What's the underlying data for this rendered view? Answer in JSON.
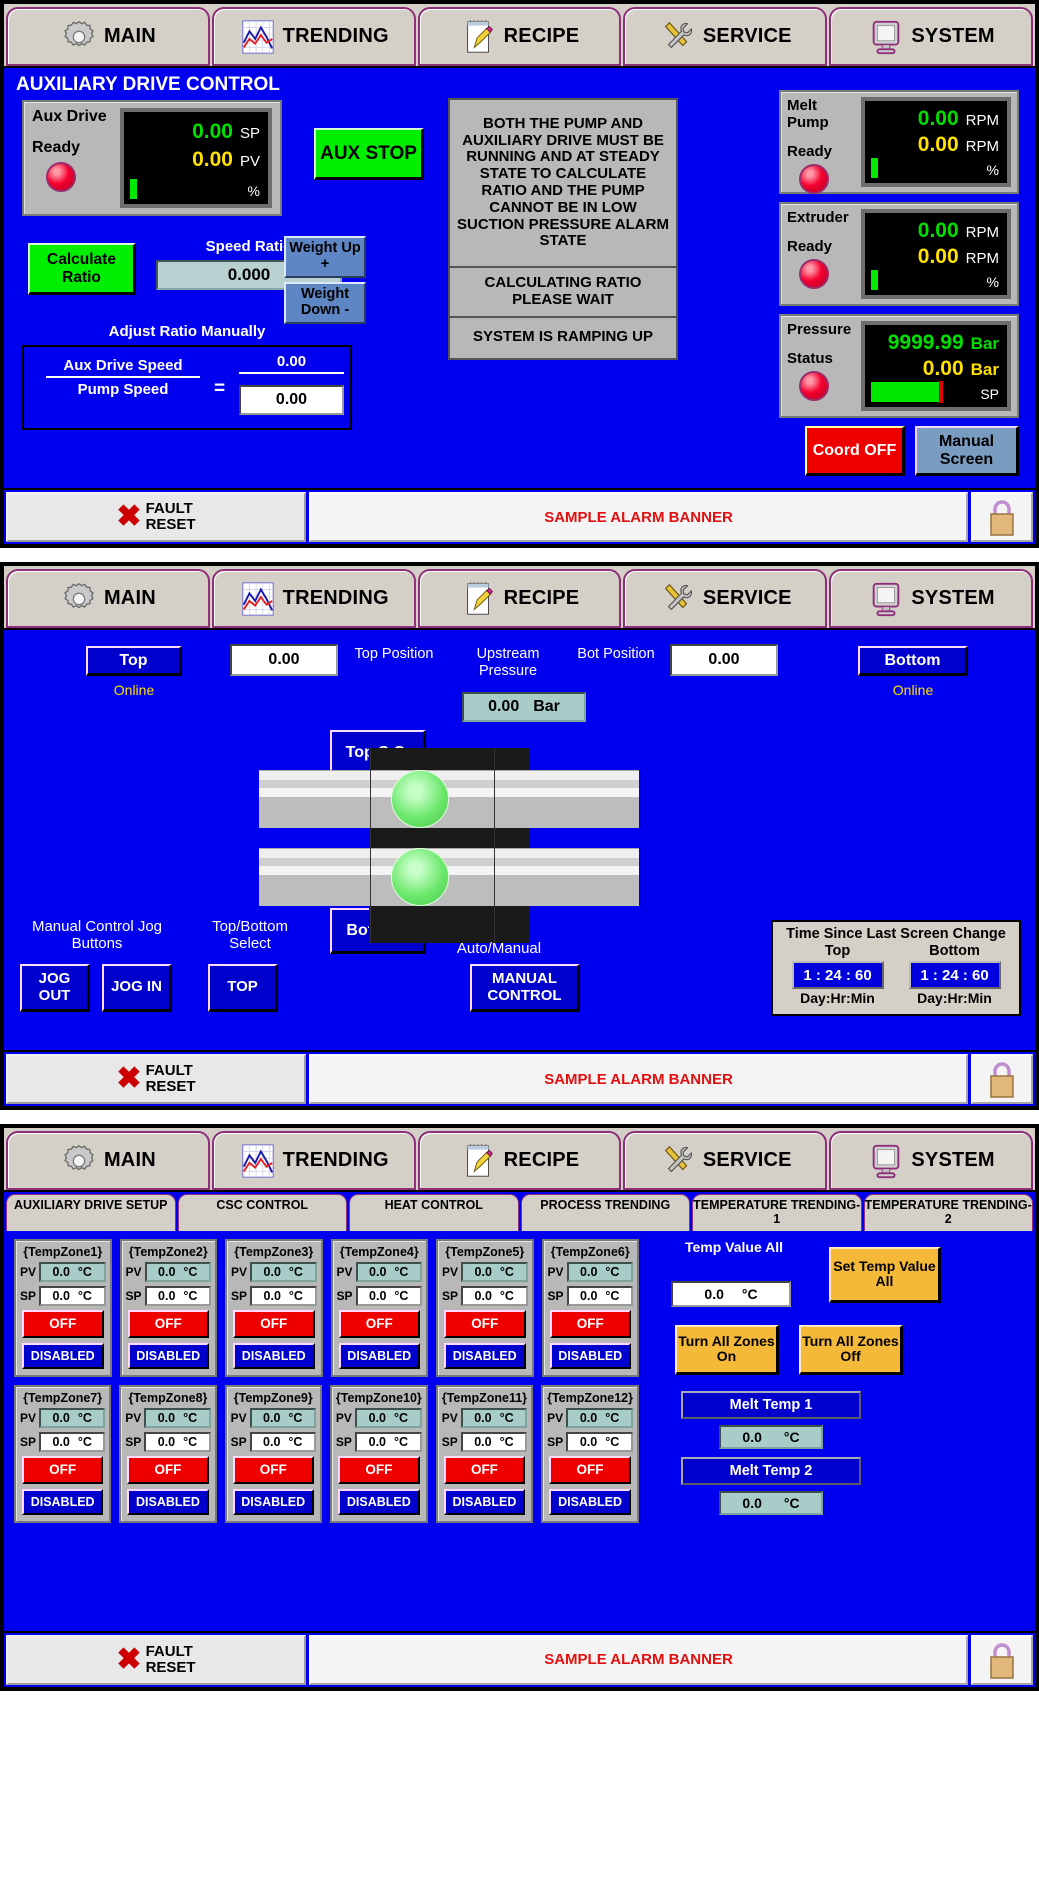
{
  "nav": {
    "items": [
      {
        "label": "MAIN",
        "icon": "gear-icon"
      },
      {
        "label": "TRENDING",
        "icon": "chart-icon"
      },
      {
        "label": "RECIPE",
        "icon": "notepad-pencil-icon"
      },
      {
        "label": "SERVICE",
        "icon": "wrench-screwdriver-icon"
      },
      {
        "label": "SYSTEM",
        "icon": "monitor-icon"
      }
    ]
  },
  "footer": {
    "fault_line1": "FAULT",
    "fault_line2": "RESET",
    "fault_icon": "red-x-icon",
    "alarm_banner": "SAMPLE ALARM BANNER",
    "lock_icon": "padlock-icon"
  },
  "screen1": {
    "title": "AUXILIARY DRIVE CONTROL",
    "aux_drive": {
      "name": "Aux Drive",
      "status": "Ready",
      "sp_value": "0.00",
      "sp_unit": "SP",
      "pv_value": "0.00",
      "pv_unit": "PV",
      "bar_unit": "%"
    },
    "aux_stop_label": "AUX STOP",
    "calculate_ratio_label": "Calculate Ratio",
    "speed_ratio_label": "Speed Ratio",
    "speed_ratio_value": "0.000",
    "weight_up_label": "Weight Up +",
    "weight_down_label": "Weight Down -",
    "adjust_ratio_label": "Adjust Ratio Manually",
    "numerator_label": "Aux Drive Speed",
    "denominator_label": "Pump Speed",
    "equals": "=",
    "ratio_numerator_value": "0.00",
    "ratio_denominator_value": "0.00",
    "message_main": "BOTH THE PUMP AND AUXILIARY DRIVE MUST BE RUNNING AND AT STEADY STATE TO CALCULATE RATIO AND THE PUMP CANNOT BE IN LOW SUCTION PRESSURE ALARM STATE",
    "message_mid": "CALCULATING RATIO PLEASE WAIT",
    "message_bot": "SYSTEM IS RAMPING UP",
    "melt_pump": {
      "name": "Melt Pump",
      "status": "Ready",
      "sp_value": "0.00",
      "sp_unit": "RPM",
      "pv_value": "0.00",
      "pv_unit": "RPM",
      "bar_unit": "%"
    },
    "extruder": {
      "name": "Extruder",
      "status": "Ready",
      "sp_value": "0.00",
      "sp_unit": "RPM",
      "pv_value": "0.00",
      "pv_unit": "RPM",
      "bar_unit": "%"
    },
    "pressure": {
      "name": "Pressure",
      "status": "Status",
      "sp_value": "9999.99",
      "sp_unit": "Bar",
      "pv_value": "0.00",
      "pv_unit": "Bar",
      "bar_unit": "SP"
    },
    "coord_label": "Coord OFF",
    "manual_screen_label": "Manual Screen"
  },
  "screen2": {
    "top_button": "Top",
    "top_online": "Online",
    "top_value": "0.00",
    "top_position_label": "Top Position",
    "upstream_pressure_label": "Upstream Pressure",
    "pressure_value": "0.00",
    "pressure_unit": "Bar",
    "bot_position_label": "Bot Position",
    "bot_value": "0.00",
    "bottom_button": "Bottom",
    "bottom_online": "Online",
    "top_sc_label": "Top S.C.",
    "bot_sc_label": "Bot S.C.",
    "jog_caption": "Manual Control Jog Buttons",
    "topbottom_caption": "Top/Bottom Select",
    "jog_out_label": "JOG OUT",
    "jog_in_label": "JOG IN",
    "top_select_label": "TOP",
    "auto_manual_caption": "Auto/Manual",
    "manual_control_label": "MANUAL CONTROL",
    "time_title": "Time Since Last Screen Change",
    "time_top_header": "Top",
    "time_bottom_header": "Bottom",
    "time_top_value": "1 : 24 : 60",
    "time_bottom_value": "1 : 24 : 60",
    "time_format": "Day:Hr:Min"
  },
  "screen3": {
    "subtabs": [
      "AUXILIARY DRIVE SETUP",
      "CSC CONTROL",
      "HEAT CONTROL",
      "PROCESS TRENDING",
      "TEMPERATURE TRENDING-1",
      "TEMPERATURE TRENDING-2"
    ],
    "pv_key": "PV",
    "sp_key": "SP",
    "unit": "°C",
    "zones": [
      {
        "name": "{TempZone1}",
        "pv": "0.0",
        "sp": "0.0",
        "state": "OFF",
        "enable": "DISABLED"
      },
      {
        "name": "{TempZone2}",
        "pv": "0.0",
        "sp": "0.0",
        "state": "OFF",
        "enable": "DISABLED"
      },
      {
        "name": "{TempZone3}",
        "pv": "0.0",
        "sp": "0.0",
        "state": "OFF",
        "enable": "DISABLED"
      },
      {
        "name": "{TempZone4}",
        "pv": "0.0",
        "sp": "0.0",
        "state": "OFF",
        "enable": "DISABLED"
      },
      {
        "name": "{TempZone5}",
        "pv": "0.0",
        "sp": "0.0",
        "state": "OFF",
        "enable": "DISABLED"
      },
      {
        "name": "{TempZone6}",
        "pv": "0.0",
        "sp": "0.0",
        "state": "OFF",
        "enable": "DISABLED"
      },
      {
        "name": "{TempZone7}",
        "pv": "0.0",
        "sp": "0.0",
        "state": "OFF",
        "enable": "DISABLED"
      },
      {
        "name": "{TempZone8}",
        "pv": "0.0",
        "sp": "0.0",
        "state": "OFF",
        "enable": "DISABLED"
      },
      {
        "name": "{TempZone9}",
        "pv": "0.0",
        "sp": "0.0",
        "state": "OFF",
        "enable": "DISABLED"
      },
      {
        "name": "{TempZone10}",
        "pv": "0.0",
        "sp": "0.0",
        "state": "OFF",
        "enable": "DISABLED"
      },
      {
        "name": "{TempZone11}",
        "pv": "0.0",
        "sp": "0.0",
        "state": "OFF",
        "enable": "DISABLED"
      },
      {
        "name": "{TempZone12}",
        "pv": "0.0",
        "sp": "0.0",
        "state": "OFF",
        "enable": "DISABLED"
      }
    ],
    "temp_value_all_label": "Temp Value All",
    "temp_value_all_value": "0.0",
    "set_temp_value_all_label": "Set Temp Value All",
    "turn_all_on_label": "Turn All Zones On",
    "turn_all_off_label": "Turn All Zones Off",
    "melt_temp_1_label": "Melt Temp 1",
    "melt_temp_1_value": "0.0",
    "melt_temp_2_label": "Melt Temp 2",
    "melt_temp_2_value": "0.0"
  },
  "colors": {
    "background_blue": "#0000ee",
    "alarm_red": "#e01010",
    "led_red": "#f5002f",
    "go_green": "#00ef00",
    "accent_orange": "#f5b93a"
  }
}
